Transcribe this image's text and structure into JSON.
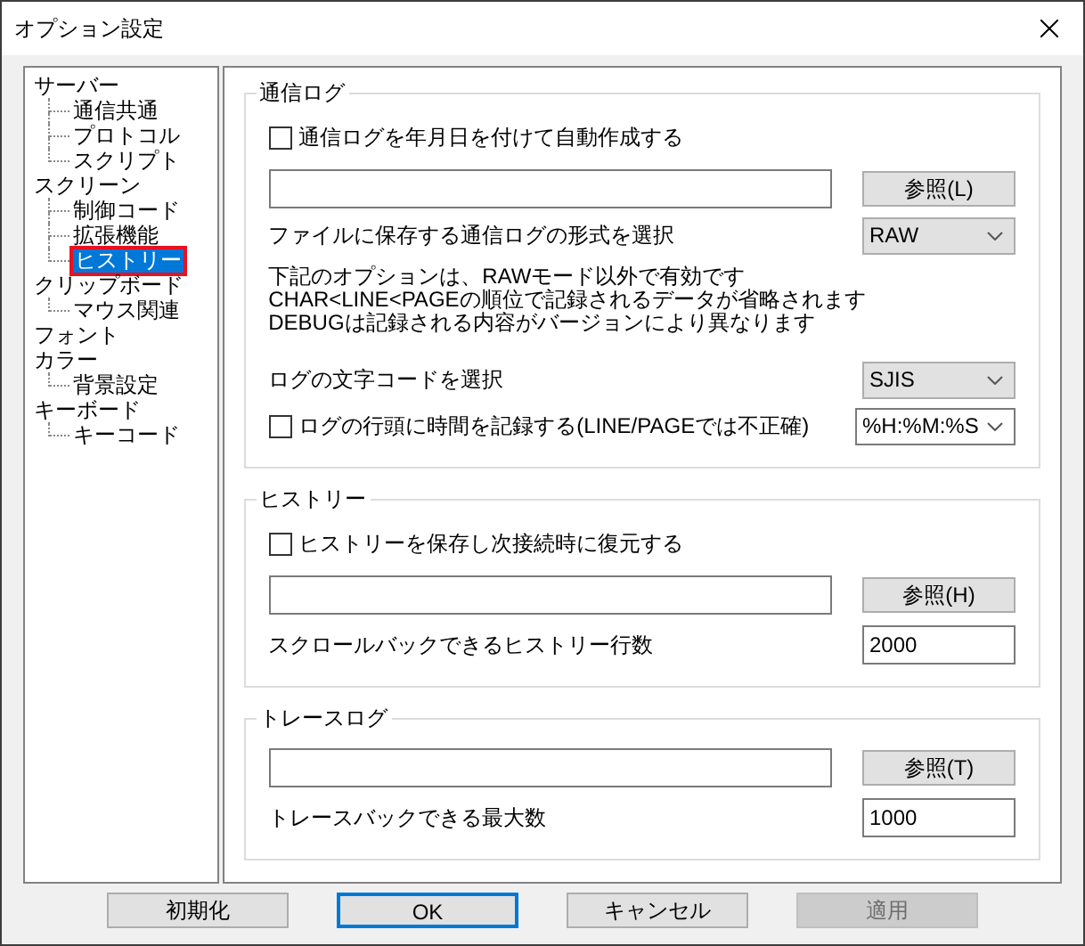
{
  "window": {
    "title": "オプション設定"
  },
  "tree": [
    {
      "label": "サーバー",
      "selected": false,
      "children": [
        {
          "label": "通信共通",
          "selected": false
        },
        {
          "label": "プロトコル",
          "selected": false
        },
        {
          "label": "スクリプト",
          "selected": false
        }
      ]
    },
    {
      "label": "スクリーン",
      "selected": false,
      "children": [
        {
          "label": "制御コード",
          "selected": false
        },
        {
          "label": "拡張機能",
          "selected": false
        },
        {
          "label": "ヒストリー",
          "selected": true
        }
      ]
    },
    {
      "label": "クリップボード",
      "selected": false,
      "children": [
        {
          "label": "マウス関連",
          "selected": false
        }
      ]
    },
    {
      "label": "フォント",
      "selected": false
    },
    {
      "label": "カラー",
      "selected": false,
      "children": [
        {
          "label": "背景設定",
          "selected": false
        }
      ]
    },
    {
      "label": "キーボード",
      "selected": false,
      "children": [
        {
          "label": "キーコード",
          "selected": false
        }
      ]
    }
  ],
  "sections": [
    {
      "title": "通信ログ",
      "rows": [
        {
          "kind": "checkbox",
          "label": "通信ログを年月日を付けて自動作成する",
          "checked": false
        },
        {
          "kind": "path",
          "button": "参照(L)"
        },
        {
          "kind": "select",
          "label": "ファイルに保存する通信ログの形式を選択",
          "value": "RAW",
          "editable": false
        },
        {
          "kind": "note",
          "lines": [
            "下記のオプションは、RAWモード以外で有効です",
            "CHAR<LINE<PAGEの順位で記録されるデータが省略されます",
            "DEBUGは記録される内容がバージョンにより異なります"
          ]
        },
        {
          "kind": "select",
          "label": "ログの文字コードを選択",
          "value": "SJIS",
          "editable": false
        },
        {
          "kind": "checkselect",
          "label": "ログの行頭に時間を記録する(LINE/PAGEでは不正確)",
          "checked": false,
          "value": "%H:%M:%S",
          "editable": true
        }
      ]
    },
    {
      "title": "ヒストリー",
      "rows": [
        {
          "kind": "checkbox",
          "label": "ヒストリーを保存し次接続時に復元する",
          "checked": false
        },
        {
          "kind": "path",
          "button": "参照(H)"
        },
        {
          "kind": "number",
          "label": "スクロールバックできるヒストリー行数",
          "value": "2000"
        }
      ]
    },
    {
      "title": "トレースログ",
      "rows": [
        {
          "kind": "path",
          "button": "参照(T)"
        },
        {
          "kind": "number",
          "label": "トレースバックできる最大数",
          "value": "1000"
        }
      ]
    }
  ],
  "buttons": [
    {
      "label": "初期化",
      "default": false,
      "disabled": false
    },
    {
      "label": "OK",
      "default": true,
      "disabled": false
    },
    {
      "label": "キャンセル",
      "default": false,
      "disabled": false
    },
    {
      "label": "適用",
      "default": false,
      "disabled": true
    }
  ]
}
